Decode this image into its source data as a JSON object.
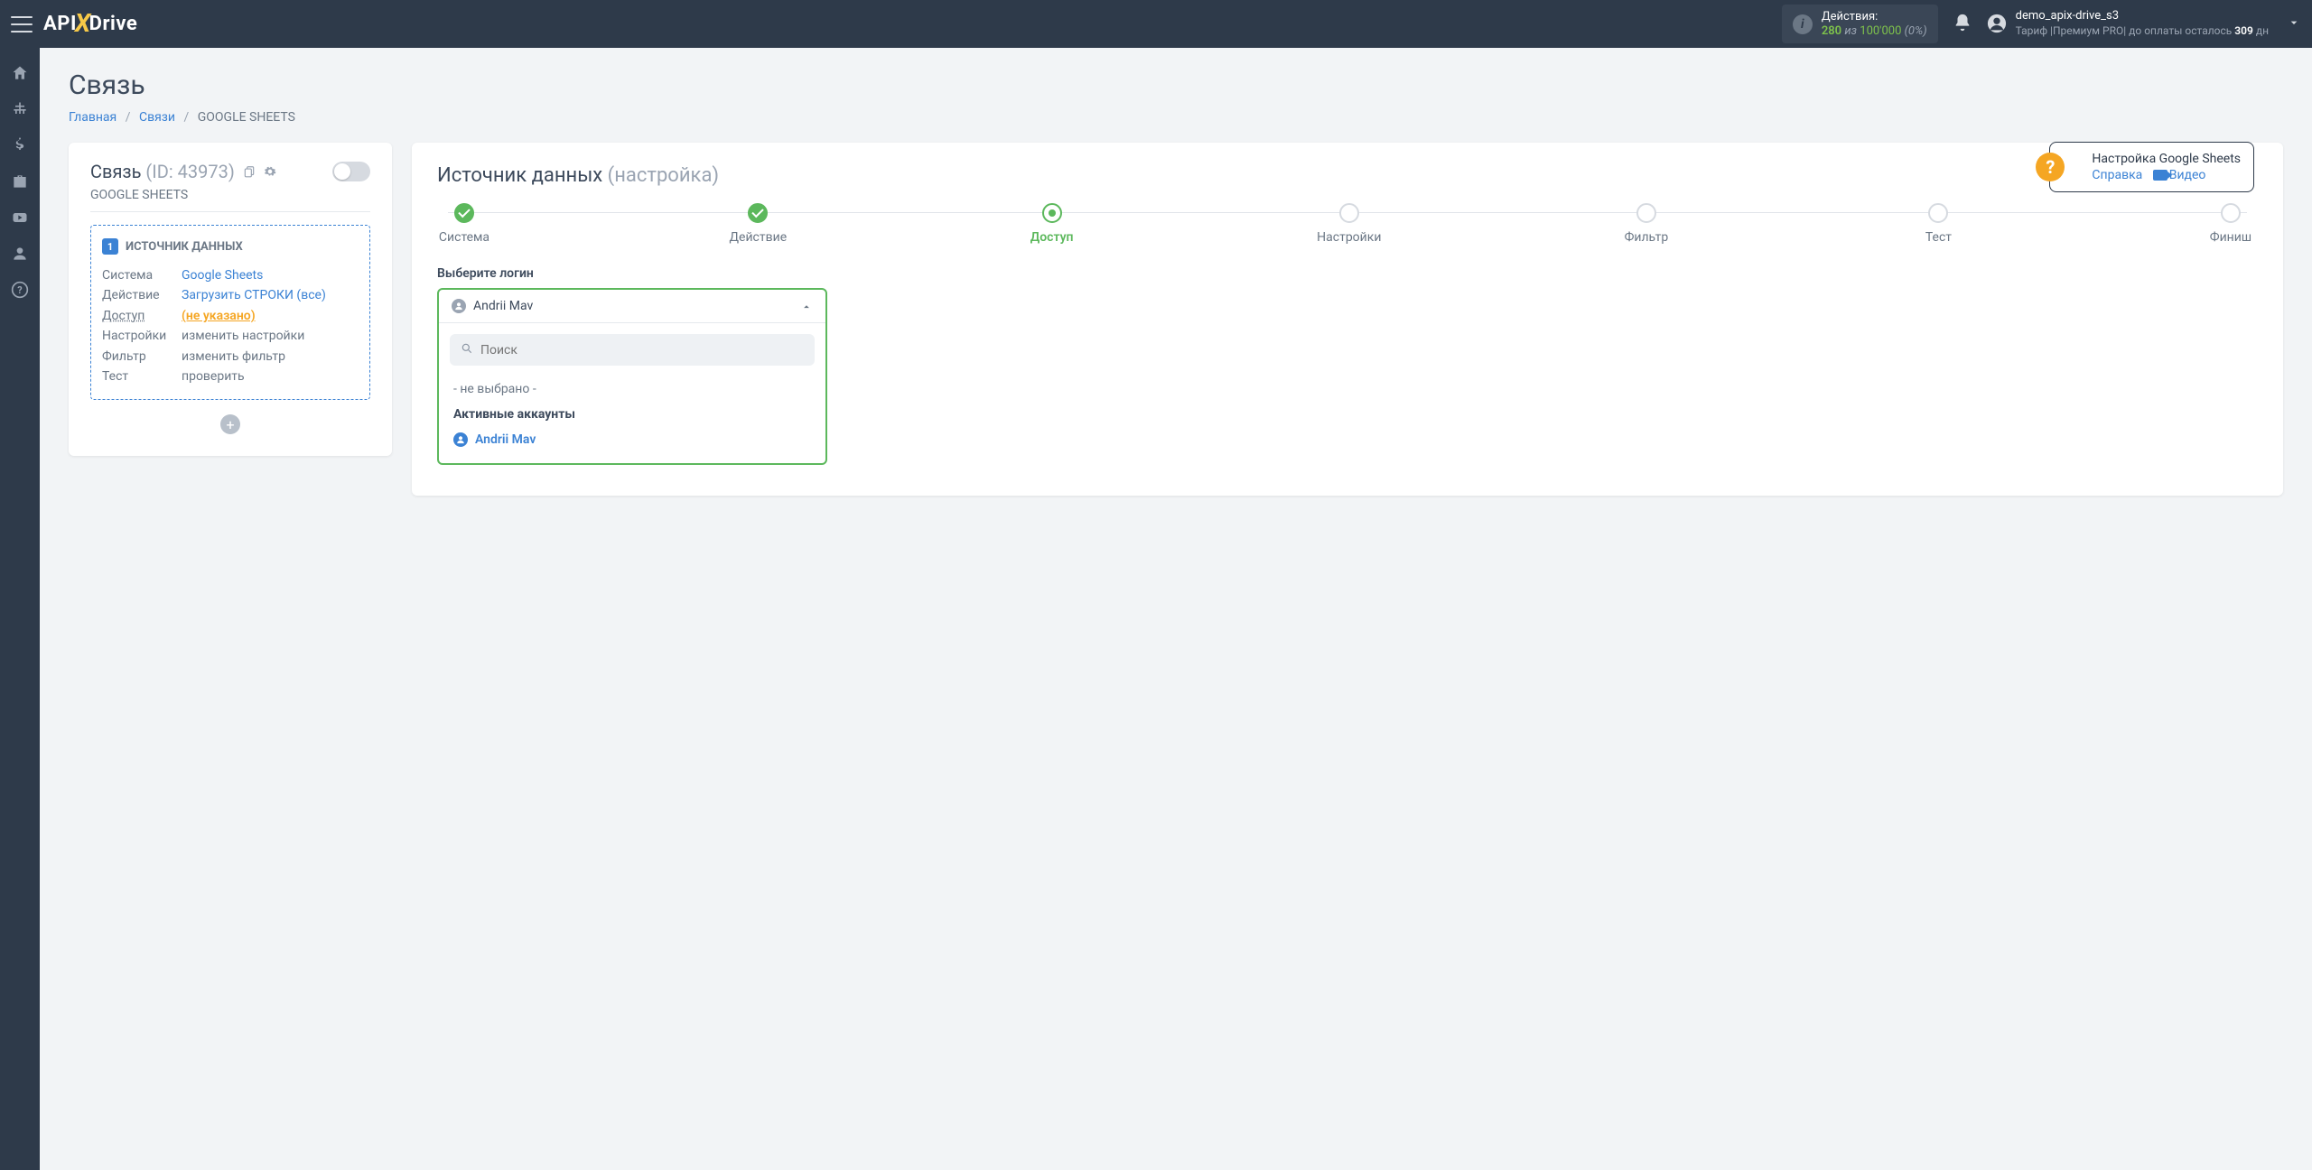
{
  "header": {
    "logo_a": "API",
    "logo_b": "Drive",
    "actions_label": "Действия:",
    "actions_used": "280",
    "actions_of": "из",
    "actions_total": "100'000",
    "actions_pct": "(0%)",
    "username": "demo_apix-drive_s3",
    "tariff_prefix": "Тариф |",
    "tariff_name": "Премиум PRO",
    "tariff_suffix": "|  до оплаты осталось ",
    "days": "309",
    "days_unit": " дн"
  },
  "page": {
    "title": "Связь",
    "crumb_home": "Главная",
    "crumb_links": "Связи",
    "crumb_current": "GOOGLE SHEETS"
  },
  "help": {
    "title": "Настройка Google Sheets",
    "ref": "Справка",
    "video": "Видео"
  },
  "left": {
    "title": "Связь",
    "id_label": "(ID: 43973)",
    "subtitle": "GOOGLE SHEETS",
    "box_header": "ИСТОЧНИК ДАННЫХ",
    "rows": [
      {
        "k": "Система",
        "v": "Google Sheets",
        "cls": "link"
      },
      {
        "k": "Действие",
        "v": "Загрузить СТРОКИ (все)",
        "cls": "link"
      },
      {
        "k": "Доступ",
        "v": "(не указано)",
        "cls": "warn",
        "ku": true
      },
      {
        "k": "Настройки",
        "v": "изменить настройки",
        "cls": ""
      },
      {
        "k": "Фильтр",
        "v": "изменить фильтр",
        "cls": ""
      },
      {
        "k": "Тест",
        "v": "проверить",
        "cls": ""
      }
    ]
  },
  "right": {
    "title_main": "Источник данных",
    "title_sub": "(настройка)",
    "steps": [
      {
        "label": "Система",
        "state": "done"
      },
      {
        "label": "Действие",
        "state": "done"
      },
      {
        "label": "Доступ",
        "state": "active"
      },
      {
        "label": "Настройки",
        "state": ""
      },
      {
        "label": "Фильтр",
        "state": ""
      },
      {
        "label": "Тест",
        "state": ""
      },
      {
        "label": "Финиш",
        "state": ""
      }
    ],
    "field_label": "Выберите логин",
    "selected": "Andrii Mav",
    "search_placeholder": "Поиск",
    "opt_none": "- не выбрано -",
    "group_label": "Активные аккаунты",
    "account": "Andrii Mav"
  }
}
